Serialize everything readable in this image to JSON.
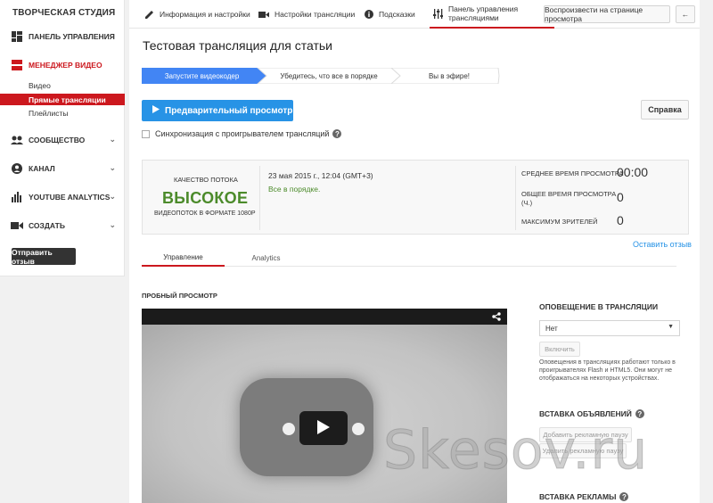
{
  "sidebar": {
    "title": "ТВОРЧЕСКАЯ СТУДИЯ",
    "dashboard": "ПАНЕЛЬ УПРАВЛЕНИЯ",
    "video_manager": "МЕНЕДЖЕР ВИДЕО",
    "sub_videos": "Видео",
    "sub_live": "Прямые трансляции",
    "sub_playlists": "Плейлисты",
    "community": "СООБЩЕСТВО",
    "channel": "КАНАЛ",
    "analytics": "YOUTUBE ANALYTICS",
    "create": "СОЗДАТЬ",
    "feedback_button": "Отправить отзыв"
  },
  "topbar": {
    "tab_info": "Информация и настройки",
    "tab_stream_settings": "Настройки трансляции",
    "tab_tips": "Подсказки",
    "tab_control_room": "Панель управления трансляциями",
    "play_on_watch_page": "Воспроизвести на странице просмотра",
    "back_icon": "←"
  },
  "page": {
    "title": "Тестовая трансляция для статьи"
  },
  "steps": [
    "Запустите видеокодер",
    "Убедитесь, что все в порядке",
    "Вы в эфире!"
  ],
  "actions": {
    "preview_button": "Предварительный просмотр",
    "help_button": "Справка",
    "sync_label": "Синхронизация с проигрывателем трансляций"
  },
  "stats": {
    "quality_label": "КАЧЕСТВО ПОТОКА",
    "quality_value": "ВЫСОКОЕ",
    "quality_sub": "ВИДЕОПОТОК В ФОРМАТЕ 1080P",
    "date": "23 мая 2015 г., 12:04 (GMT+3)",
    "status": "Все в порядке.",
    "avg_watch_label": "СРЕДНЕЕ ВРЕМЯ ПРОСМОТРА",
    "avg_watch_value": "00:00",
    "total_watch_label_1": "ОБЩЕЕ ВРЕМЯ ПРОСМОТРА",
    "total_watch_label_2": "(Ч.)",
    "total_watch_value": "0",
    "max_viewers_label": "МАКСИМУМ ЗРИТЕЛЕЙ",
    "max_viewers_value": "0"
  },
  "feedback_link": "Оставить отзыв",
  "content_tabs": [
    "Управление",
    "Analytics"
  ],
  "preview": {
    "label": "ПРОБНЫЙ ПРОСМОТР"
  },
  "right_panel": {
    "notify_title": "ОПОВЕЩЕНИЕ В ТРАНСЛЯЦИИ",
    "select_value": "Нет",
    "enable_button": "Включить",
    "note": "Оповещения в трансляциях работают только в проигрывателях Flash и HTML5. Они могут не отображаться на некоторых устройствах.",
    "ads_title": "ВСТАВКА ОБЪЯВЛЕНИЙ",
    "add_pause_button": "Добавить рекламную паузу",
    "remove_pause_button": "Удалить рекламную паузу",
    "ads2_title": "ВСТАВКА РЕКЛАМЫ"
  },
  "watermark": "Skesov.ru",
  "colors": {
    "accent_red": "#cc181e",
    "step_active": "#4285f4",
    "preview_blue": "#2793e6",
    "quality_green": "#4c8b2b"
  }
}
